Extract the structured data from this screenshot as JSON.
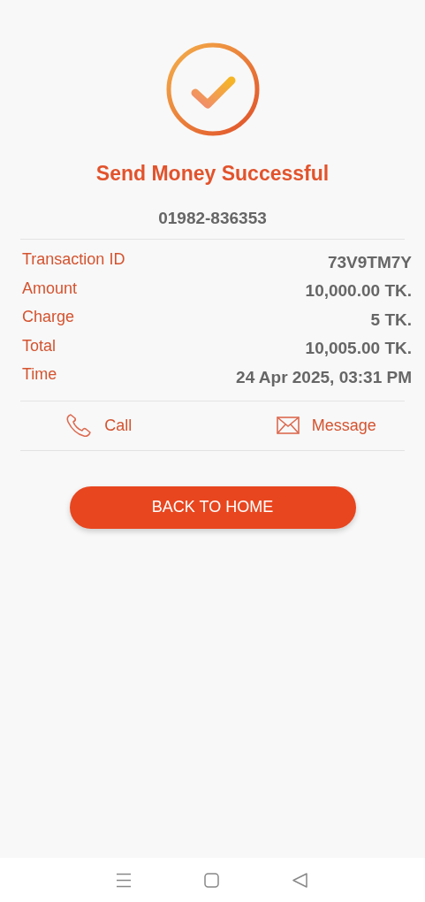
{
  "title": "Send Money Successful",
  "recipient": "01982-836353",
  "details": [
    {
      "label": "Transaction ID",
      "value": "73V9TM7Y"
    },
    {
      "label": "Amount",
      "value": "10,000.00 TK."
    },
    {
      "label": "Charge",
      "value": "5 TK."
    },
    {
      "label": "Total",
      "value": "10,005.00 TK."
    },
    {
      "label": "Time",
      "value": "24 Apr 2025, 03:31 PM"
    }
  ],
  "actions": [
    {
      "kind": "call",
      "label": "Call"
    },
    {
      "kind": "message",
      "label": "Message"
    }
  ],
  "primary_button": "BACK TO HOME",
  "nav_bar": [
    {
      "kind": "menu"
    },
    {
      "kind": "home"
    },
    {
      "kind": "back"
    }
  ]
}
